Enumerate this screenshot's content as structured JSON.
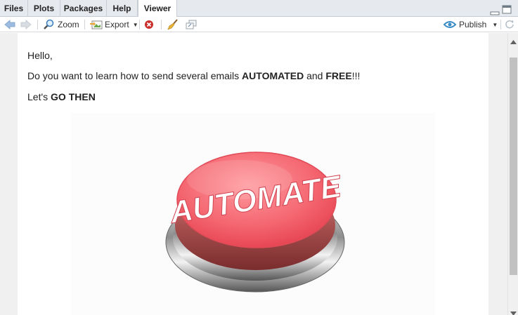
{
  "tabs": [
    {
      "label": "Files"
    },
    {
      "label": "Plots"
    },
    {
      "label": "Packages"
    },
    {
      "label": "Help"
    },
    {
      "label": "Viewer"
    }
  ],
  "toolbar": {
    "zoom_label": "Zoom",
    "export_label": "Export",
    "publish_label": "Publish"
  },
  "content": {
    "greeting": "Hello,",
    "line2_prefix": "Do you want to learn how to send several emails ",
    "line2_bold1": "AUTOMATED",
    "line2_mid": " and ",
    "line2_bold2": "FREE",
    "line2_suffix": "!!!",
    "line3_prefix": "Let's ",
    "line3_bold": "GO THEN",
    "button_text": "AUTOMATE"
  },
  "colors": {
    "button_red": "#f0505e",
    "accent_blue": "#3c8dc5"
  }
}
